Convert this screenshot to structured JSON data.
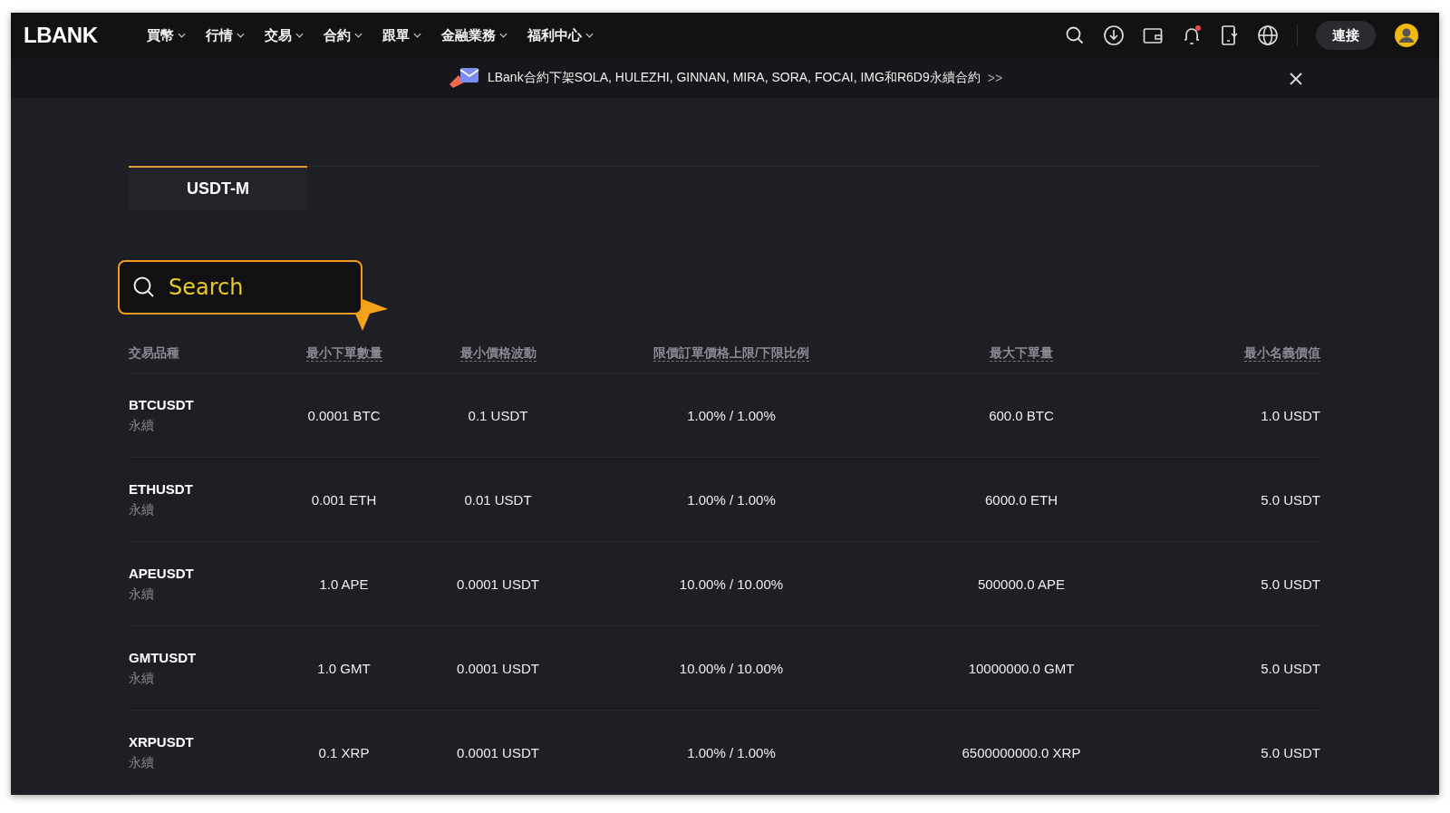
{
  "nav": {
    "logo": "LBANK",
    "items": [
      {
        "label": "買幣"
      },
      {
        "label": "行情"
      },
      {
        "label": "交易"
      },
      {
        "label": "合約"
      },
      {
        "label": "跟單"
      },
      {
        "label": "金融業務"
      },
      {
        "label": "福利中心"
      }
    ],
    "connect": "連接",
    "notification_dot": true
  },
  "banner": {
    "text": "LBank合約下架SOLA, HULEZHI, GINNAN, MIRA, SORA, FOCAI, IMG和R6D9永續合約",
    "more": ">>"
  },
  "tabs": [
    {
      "label": "USDT-M",
      "selected": true
    }
  ],
  "search": {
    "placeholder": "Search"
  },
  "table": {
    "columns": [
      "交易品種",
      "最小下單數量",
      "最小價格波動",
      "限價訂單價格上限/下限比例",
      "最大下單量",
      "最小名義價值"
    ],
    "rows": [
      {
        "cells": [
          "BTCUSDT",
          "0.0001 BTC",
          "0.1 USDT",
          "1.00% / 1.00%",
          "600.0 BTC",
          "1.0 USDT"
        ],
        "subtitle": "永續"
      },
      {
        "cells": [
          "ETHUSDT",
          "0.001 ETH",
          "0.01 USDT",
          "1.00% / 1.00%",
          "6000.0 ETH",
          "5.0 USDT"
        ],
        "subtitle": "永續"
      },
      {
        "cells": [
          "APEUSDT",
          "1.0 APE",
          "0.0001 USDT",
          "10.00% / 10.00%",
          "500000.0 APE",
          "5.0 USDT"
        ],
        "subtitle": "永續"
      },
      {
        "cells": [
          "GMTUSDT",
          "1.0 GMT",
          "0.0001 USDT",
          "10.00% / 10.00%",
          "10000000.0 GMT",
          "5.0 USDT"
        ],
        "subtitle": "永續"
      },
      {
        "cells": [
          "XRPUSDT",
          "0.1 XRP",
          "0.0001 USDT",
          "1.00% / 1.00%",
          "6500000000.0 XRP",
          "5.0 USDT"
        ],
        "subtitle": "永續"
      }
    ]
  }
}
